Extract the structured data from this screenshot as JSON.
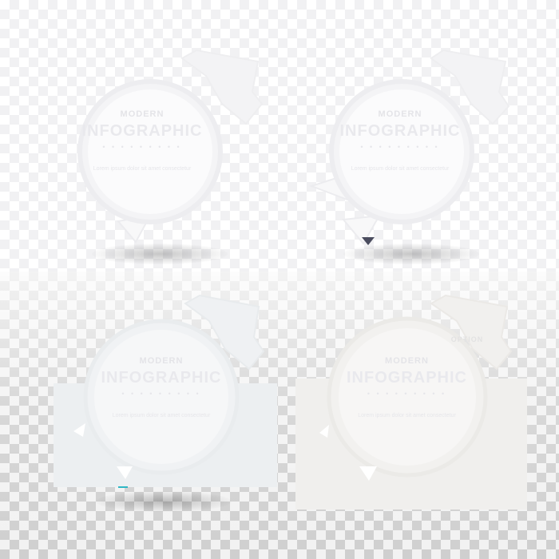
{
  "colors": {
    "background_top": "#ffffff",
    "checker_top": "#f1f1f3",
    "background_bottom": "#f2f2f2",
    "checker_bottom": "#cfcfcf",
    "card_fill_1": "#f7f7f8",
    "card_fill_2": "#f6f6f7",
    "card_fill_3": "#eceff1",
    "card_fill_4": "#f0efed",
    "accent_dark_triangle": "#4a4c5e",
    "accent_teal_line": "#2fb7c4"
  },
  "cards": [
    {
      "subtitle": "MODERN",
      "title": "INFOGRAPHIC",
      "dots": "• • • • • • • • •",
      "body": "Lorem ipsum dolor sit amet consectetur",
      "option": ""
    },
    {
      "subtitle": "MODERN",
      "title": "INFOGRAPHIC",
      "dots": "• • • • • • • • •",
      "body": "Lorem ipsum dolor sit amet consectetur",
      "option": ""
    },
    {
      "subtitle": "MODERN",
      "title": "INFOGRAPHIC",
      "dots": "• • • • • • • • •",
      "body": "Lorem ipsum dolor sit amet consectetur",
      "option": ""
    },
    {
      "subtitle": "MODERN",
      "title": "INFOGRAPHIC",
      "dots": "• • • • • • • • •",
      "body": "Lorem ipsum dolor sit amet consectetur",
      "option": "OPTION"
    }
  ]
}
